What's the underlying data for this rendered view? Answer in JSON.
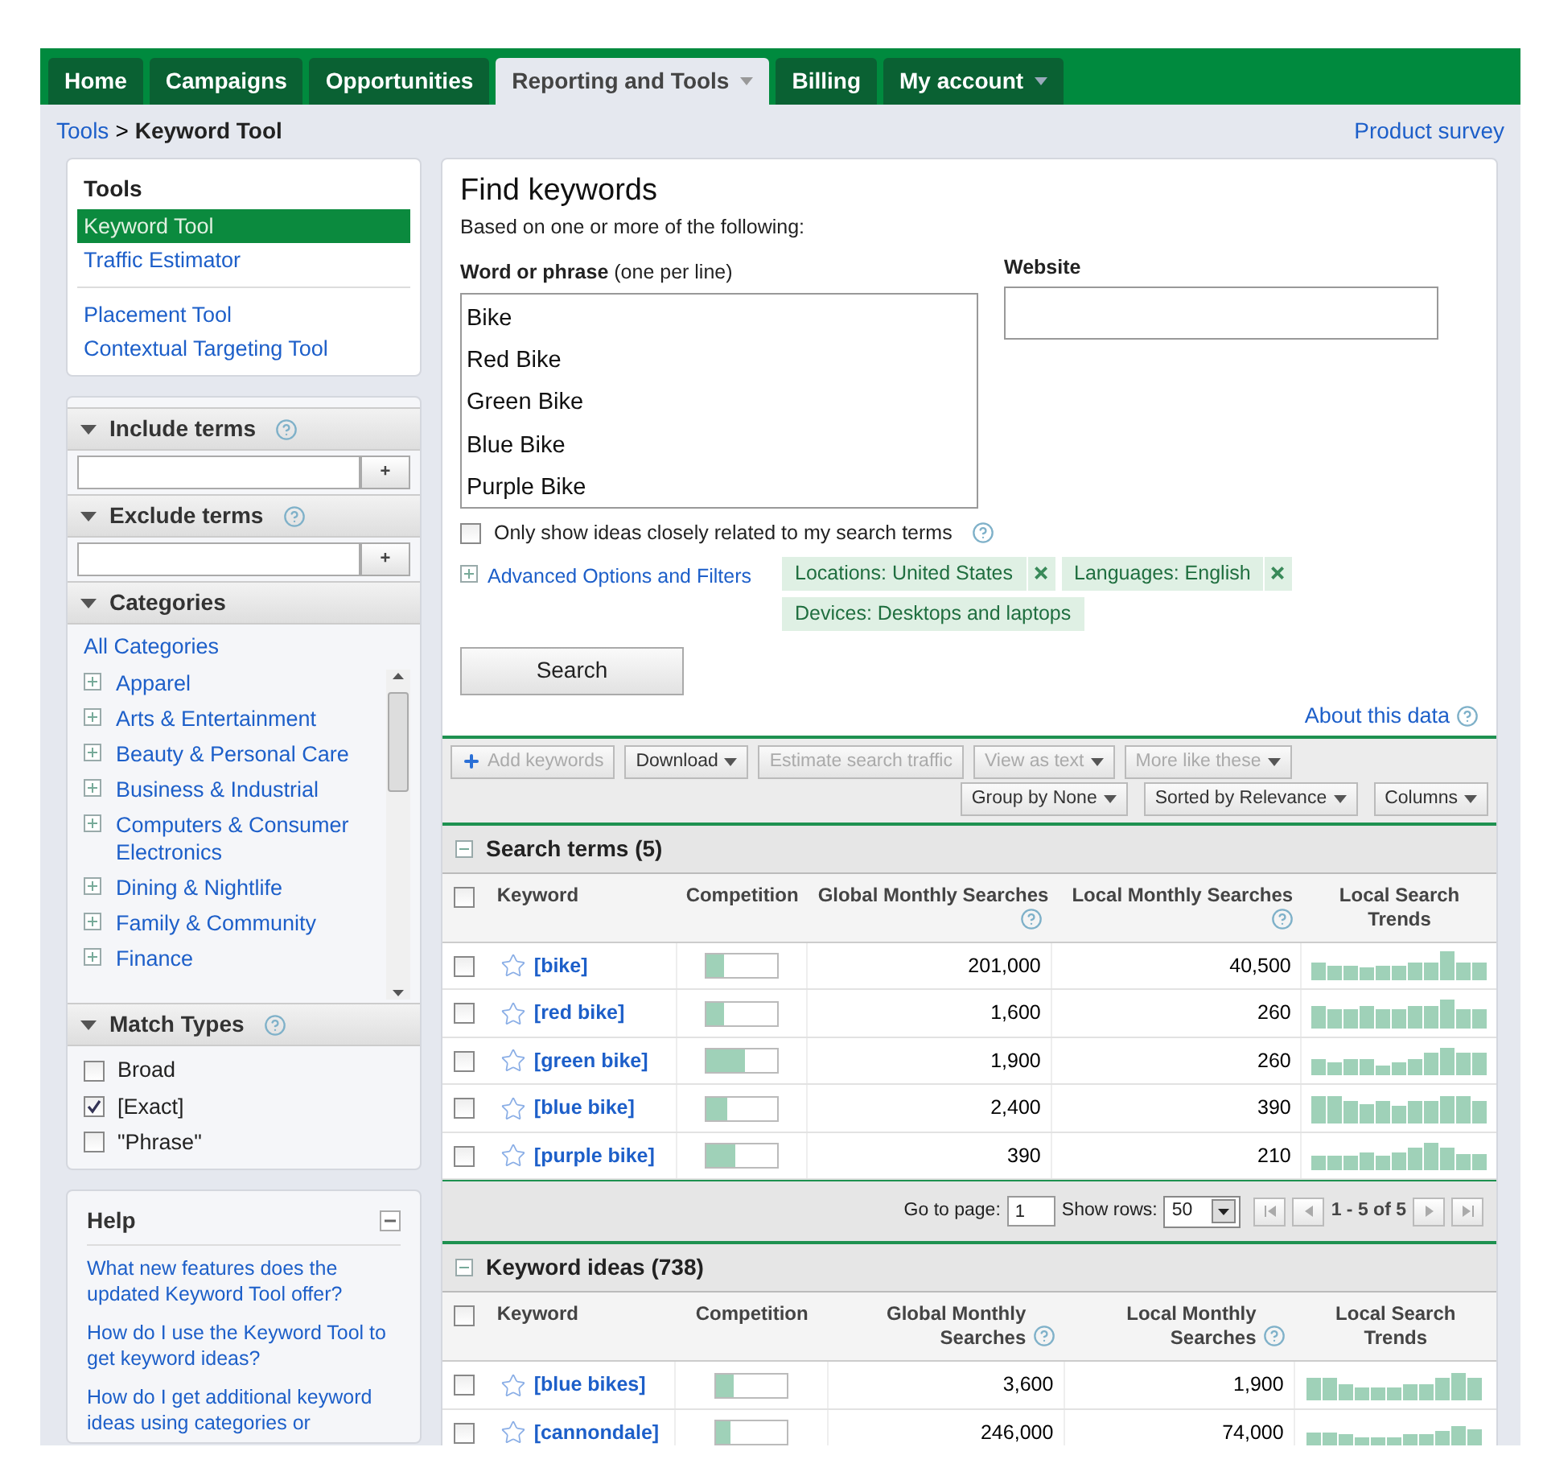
{
  "nav_tabs": [
    {
      "label": "Home",
      "selected": false,
      "dropdown": false
    },
    {
      "label": "Campaigns",
      "selected": false,
      "dropdown": false
    },
    {
      "label": "Opportunities",
      "selected": false,
      "dropdown": false
    },
    {
      "label": "Reporting and Tools",
      "selected": true,
      "dropdown": true
    },
    {
      "label": "Billing",
      "selected": false,
      "dropdown": false
    },
    {
      "label": "My account",
      "selected": false,
      "dropdown": true
    }
  ],
  "breadcrumb": {
    "parent": "Tools",
    "separator": ">",
    "current": "Keyword Tool"
  },
  "product_survey": "Product survey",
  "tools_panel": {
    "title": "Tools",
    "groups": [
      [
        {
          "label": "Keyword Tool",
          "selected": true
        },
        {
          "label": "Traffic Estimator",
          "selected": false
        }
      ],
      [
        {
          "label": "Placement Tool",
          "selected": false
        },
        {
          "label": "Contextual Targeting Tool",
          "selected": false
        }
      ]
    ]
  },
  "include_terms": {
    "title": "Include terms",
    "button": "+"
  },
  "exclude_terms": {
    "title": "Exclude terms",
    "button": "+"
  },
  "categories": {
    "title": "Categories",
    "all": "All Categories",
    "items": [
      "Apparel",
      "Arts & Entertainment",
      "Beauty & Personal Care",
      "Business & Industrial",
      "Computers & Consumer Electronics",
      "Dining & Nightlife",
      "Family & Community",
      "Finance"
    ]
  },
  "match_types": {
    "title": "Match Types",
    "options": [
      {
        "label": "Broad",
        "checked": false
      },
      {
        "label": "[Exact]",
        "checked": true
      },
      {
        "label": "\"Phrase\"",
        "checked": false
      }
    ]
  },
  "help": {
    "title": "Help",
    "links": [
      "What new features does the updated Keyword Tool offer?",
      "How do I use the Keyword Tool to get keyword ideas?",
      "How do I get additional keyword ideas using categories or"
    ]
  },
  "find": {
    "title": "Find keywords",
    "subtitle": "Based on one or more of the following:",
    "phrase_label": "**Word or phrase** (one per line)",
    "phrases": "Bike\nRed Bike\nGreen Bike\nBlue Bike\nPurple Bike",
    "website_label": "Website",
    "closely_related": {
      "label": "Only show ideas closely related to my search terms",
      "checked": false
    },
    "advanced": "Advanced Options and Filters",
    "filters": [
      {
        "label": "Locations: United States",
        "removable": true
      },
      {
        "label": "Languages: English",
        "removable": true
      },
      {
        "label": "Devices: Desktops and laptops",
        "removable": false
      }
    ],
    "search_button": "Search",
    "about": "About this data"
  },
  "toolbar": {
    "row1": [
      {
        "label": "Add keywords",
        "disabled": true,
        "dropdown": false,
        "plus": true
      },
      {
        "label": "Download",
        "disabled": false,
        "dropdown": true,
        "plus": false
      },
      {
        "label": "Estimate search traffic",
        "disabled": true,
        "dropdown": false,
        "plus": false
      },
      {
        "label": "View as text",
        "disabled": true,
        "dropdown": true,
        "plus": false
      },
      {
        "label": "More like these",
        "disabled": true,
        "dropdown": true,
        "plus": false
      }
    ],
    "row2": [
      {
        "label": "Group by None",
        "disabled": false,
        "dropdown": true,
        "plus": false
      },
      {
        "label": "Sorted by Relevance",
        "disabled": false,
        "dropdown": true,
        "plus": false
      },
      {
        "label": "Columns",
        "disabled": false,
        "dropdown": true,
        "plus": false
      }
    ]
  },
  "search_terms": {
    "title": "Search terms (5)",
    "all_checked": false,
    "columns": [
      {
        "label": "Keyword",
        "help": false
      },
      {
        "label": "Competition",
        "help": false
      },
      {
        "label": "Global Monthly Searches",
        "help": true
      },
      {
        "label": "Local Monthly Searches",
        "help": true
      },
      {
        "label": "Local Search Trends",
        "help": false
      }
    ],
    "rows": [
      {
        "keyword": "[bike]",
        "competition": {
          "level": 0.25
        },
        "global": "201,000",
        "local": "40,500",
        "checked": false
      },
      {
        "keyword": "[red bike]",
        "competition": {
          "level": 0.25
        },
        "global": "1,600",
        "local": "260",
        "checked": false
      },
      {
        "keyword": "[green bike]",
        "competition": {
          "level": 0.55
        },
        "global": "1,900",
        "local": "260",
        "checked": false
      },
      {
        "keyword": "[blue bike]",
        "competition": {
          "level": 0.3
        },
        "global": "2,400",
        "local": "390",
        "checked": false
      },
      {
        "keyword": "[purple bike]",
        "competition": {
          "level": 0.4
        },
        "global": "390",
        "local": "210",
        "checked": false
      }
    ],
    "pager": {
      "go_label": "Go to page:",
      "page": "1",
      "rows_label": "Show rows:",
      "rows": "50",
      "range": "1 - 5 of 5"
    }
  },
  "keyword_ideas": {
    "title": "Keyword ideas (738)",
    "all_checked": false,
    "columns": [
      {
        "label": "Keyword",
        "help": false
      },
      {
        "label": "Competition",
        "help": false
      },
      {
        "label": "Global Monthly Searches",
        "help": true
      },
      {
        "label": "Local Monthly Searches",
        "help": true
      },
      {
        "label": "Local Search Trends",
        "help": false
      }
    ],
    "rows": [
      {
        "keyword": "[blue bikes]",
        "competition": {
          "level": 0.25
        },
        "global": "3,600",
        "local": "1,900",
        "checked": false
      },
      {
        "keyword": "[cannondale]",
        "competition": {
          "level": 0.2
        },
        "global": "246,000",
        "local": "74,000",
        "checked": false
      }
    ]
  }
}
